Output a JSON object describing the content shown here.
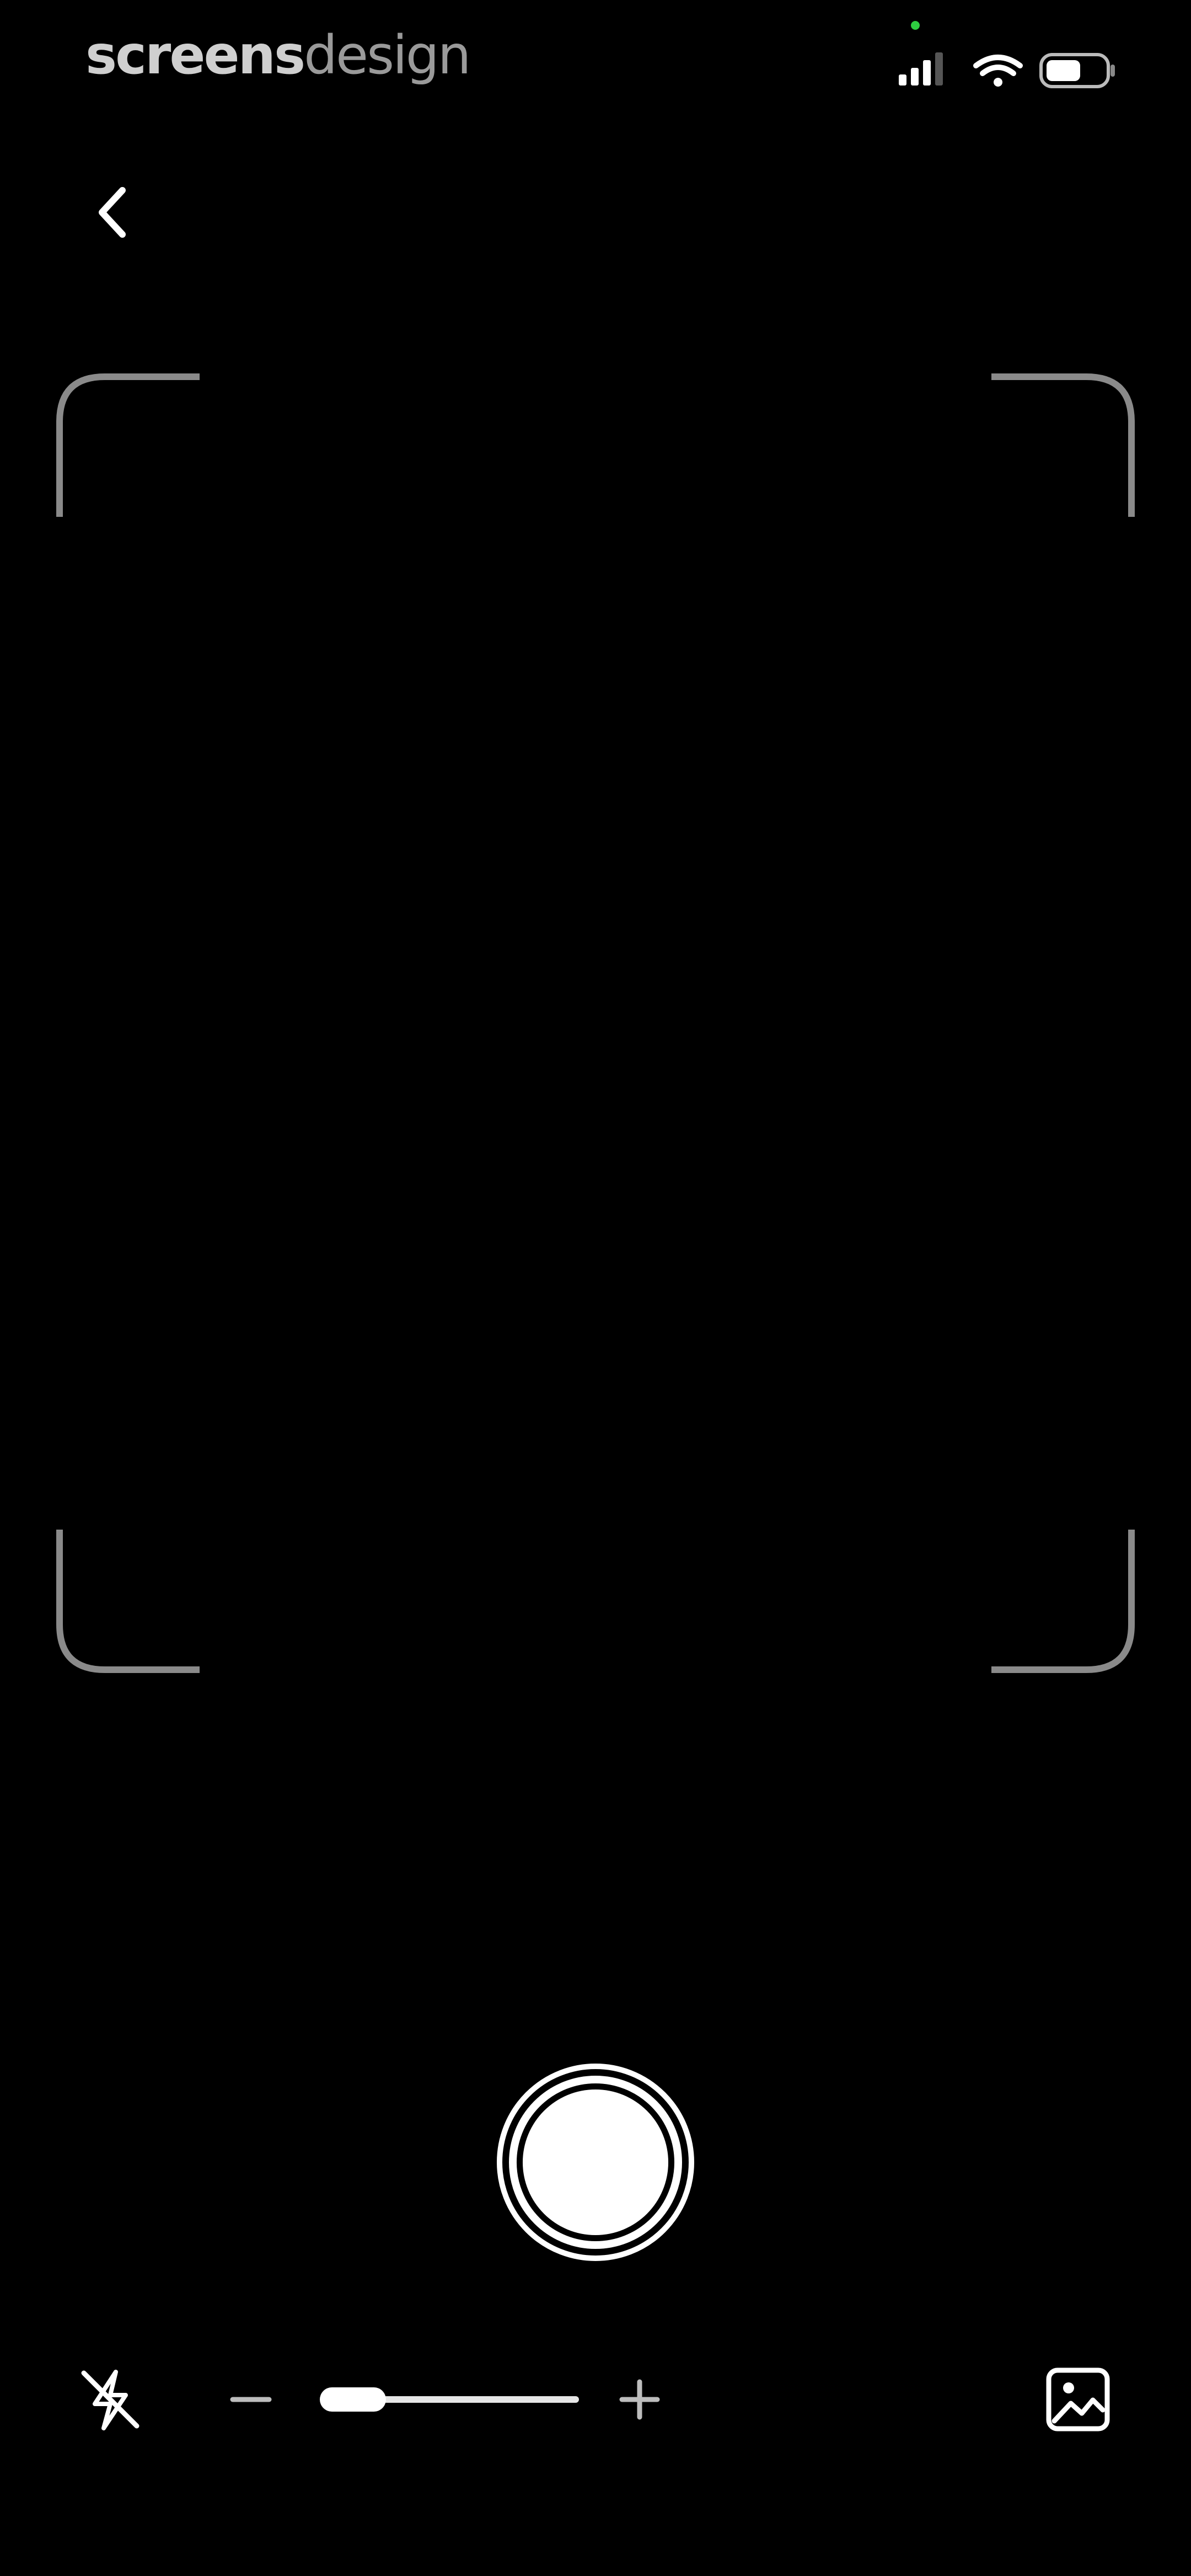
{
  "app": {
    "watermark_part1": "screens",
    "watermark_part2": "design"
  },
  "status_bar": {
    "signal_icon": "signal-icon",
    "wifi_icon": "wifi-icon",
    "battery_icon": "battery-icon",
    "battery_level": 0.6,
    "privacy_indicator_color": "#2ecc40"
  },
  "navigation": {
    "back_icon": "chevron-left-icon"
  },
  "camera": {
    "viewfinder_frame_color": "#8a8a8a",
    "shutter_icon": "shutter-button-icon"
  },
  "controls": {
    "flash_icon": "flash-off-icon",
    "zoom_minus_icon": "minus-icon",
    "zoom_plus_icon": "plus-icon",
    "zoom_level": 0.0,
    "gallery_icon": "photo-library-icon"
  }
}
